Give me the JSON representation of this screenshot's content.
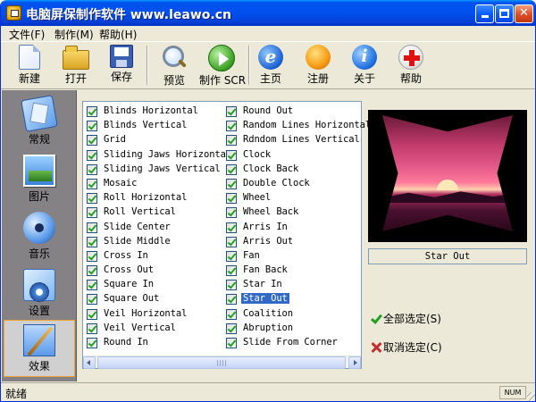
{
  "window": {
    "title": "电脑屏保制作软件 www.leawo.cn"
  },
  "menu": [
    "文件(F)",
    "制作(M)",
    "帮助(H)"
  ],
  "toolbar": {
    "new": "新建",
    "open": "打开",
    "save": "保存",
    "preview": "预览",
    "make_scr": "制作 SCR",
    "home": "主页",
    "register": "注册",
    "about": "关于",
    "help": "帮助"
  },
  "sidebar": {
    "items": [
      {
        "label": "常规",
        "icon": "normal-icon"
      },
      {
        "label": "图片",
        "icon": "picture-icon"
      },
      {
        "label": "音乐",
        "icon": "music-icon"
      },
      {
        "label": "设置",
        "icon": "settings-icon"
      },
      {
        "label": "效果",
        "icon": "effect-icon",
        "selected": true
      }
    ]
  },
  "effects": {
    "column1": [
      "Blinds Horizontal",
      "Blinds Vertical",
      "Grid",
      "Sliding Jaws Horizontal",
      "Sliding Jaws Vertical",
      "Mosaic",
      "Roll Horizontal",
      "Roll Vertical",
      "Slide Center",
      "Slide Middle",
      "Cross In",
      "Cross Out",
      "Square In",
      "Square Out",
      "Veil Horizontal",
      "Veil Vertical",
      "Round In"
    ],
    "column2": [
      "Round Out",
      "Random Lines Horizontal",
      "Rdndom Lines Vertical",
      "Clock",
      "Clock Back",
      "Double Clock",
      "Wheel",
      "Wheel Back",
      "Arris In",
      "Arris Out",
      "Fan",
      "Fan Back",
      "Star In",
      "Star Out",
      "Coalition",
      "Abruption",
      "Slide From Corner"
    ],
    "all_checked": true,
    "selected": "Star Out"
  },
  "preview": {
    "caption": "Star Out"
  },
  "actions": {
    "select_all": "全部选定(S)",
    "deselect_all": "取消选定(C)"
  },
  "status": {
    "text": "就绪",
    "num": "NUM"
  },
  "colors": {
    "titlebar": "#0053ee",
    "selection": "#316ac5",
    "check": "#21a121"
  }
}
